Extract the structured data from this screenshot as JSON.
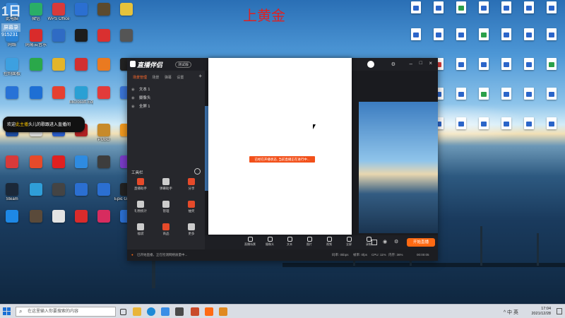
{
  "overlay": {
    "top_title": "上黄金",
    "logo_text": "1日",
    "logo_sub": "屏幕录",
    "logo_num": "915231",
    "notice_name": "此主播",
    "notice_text": "欢迎",
    "notice_rest": "头儿的歌跟进入直播间"
  },
  "desktop_icons_left": [
    {
      "label": "此电脑",
      "color": "#3c8ad8"
    },
    {
      "label": "微信",
      "color": "#2aae67"
    },
    {
      "label": "WPS Office",
      "color": "#d83a3a"
    },
    {
      "label": "",
      "color": "#2b6fd1"
    },
    {
      "label": "",
      "color": "#5b4a2e"
    },
    {
      "label": "",
      "color": "#e6c23b"
    },
    {
      "label": "网络",
      "color": "#2a83d6"
    },
    {
      "label": "网易云音乐",
      "color": "#d92b2b"
    },
    {
      "label": "",
      "color": "#2f6bc4"
    },
    {
      "label": "",
      "color": "#1d1d1d"
    },
    {
      "label": "",
      "color": "#d93030"
    },
    {
      "label": "",
      "color": "#555555"
    },
    {
      "label": "控制面板",
      "color": "#3da0e0"
    },
    {
      "label": "",
      "color": "#2aa84a"
    },
    {
      "label": "",
      "color": "#e3b52a"
    },
    {
      "label": "",
      "color": "#d23030"
    },
    {
      "label": "",
      "color": "#ea7a20"
    },
    {
      "label": "",
      "color": "#222222"
    },
    {
      "label": "",
      "color": "#2872d6"
    },
    {
      "label": "",
      "color": "#1e6fd4"
    },
    {
      "label": "",
      "color": "#e64030"
    },
    {
      "label": "Microsoft Edge",
      "color": "#2aa0d4"
    },
    {
      "label": "",
      "color": "#e23b3b"
    },
    {
      "label": "",
      "color": "#3a74d6"
    },
    {
      "label": "",
      "color": "#1e4ca0"
    },
    {
      "label": "",
      "color": "#d8d8d8"
    },
    {
      "label": "",
      "color": "#2a5cc8"
    },
    {
      "label": "",
      "color": "#b02222"
    },
    {
      "label": "PUBG",
      "color": "#c78a2a"
    },
    {
      "label": "",
      "color": "#f29a1f"
    },
    {
      "label": "",
      "color": "#d83a3a"
    },
    {
      "label": "",
      "color": "#e64a2a"
    },
    {
      "label": "",
      "color": "#e02020"
    },
    {
      "label": "",
      "color": "#2e8be0"
    },
    {
      "label": "",
      "color": "#3d3d3d"
    },
    {
      "label": "",
      "color": "#7a3bc8"
    },
    {
      "label": "Steam",
      "color": "#1b2838"
    },
    {
      "label": "",
      "color": "#2f9ed8"
    },
    {
      "label": "",
      "color": "#444444"
    },
    {
      "label": "",
      "color": "#2b6fd1"
    },
    {
      "label": "",
      "color": "#2b6fd1"
    },
    {
      "label": "Epic Games Launcher",
      "color": "#222222"
    },
    {
      "label": "",
      "color": "#1e88e5"
    },
    {
      "label": "",
      "color": "#5a4a3a"
    },
    {
      "label": "",
      "color": "#e3e3e3"
    },
    {
      "label": "",
      "color": "#d92b2b"
    },
    {
      "label": "",
      "color": "#d72c5f"
    },
    {
      "label": "",
      "color": "#2b6fd1"
    }
  ],
  "desktop_icons_right": [
    {
      "label": "",
      "color": "#2b65c9"
    },
    {
      "label": "",
      "color": "#2b65c9"
    },
    {
      "label": "",
      "color": "#2aa04a"
    },
    {
      "label": "",
      "color": "#2b65c9"
    },
    {
      "label": "",
      "color": "#2b65c9"
    },
    {
      "label": "",
      "color": "#2b65c9"
    },
    {
      "label": "",
      "color": "#2b65c9"
    },
    {
      "label": "",
      "color": "#2b65c9"
    },
    {
      "label": "",
      "color": "#2b65c9"
    },
    {
      "label": "",
      "color": "#2b65c9"
    },
    {
      "label": "",
      "color": "#2aa04a"
    },
    {
      "label": "",
      "color": "#2b65c9"
    },
    {
      "label": "",
      "color": "#2b65c9"
    },
    {
      "label": "",
      "color": "#2b65c9"
    },
    {
      "label": "",
      "color": "#2b65c9"
    },
    {
      "label": "",
      "color": "#d83a3a"
    },
    {
      "label": "",
      "color": "#2b65c9"
    },
    {
      "label": "",
      "color": "#2b65c9"
    },
    {
      "label": "",
      "color": "#2b65c9"
    },
    {
      "label": "",
      "color": "#2b65c9"
    },
    {
      "label": "",
      "color": "#2aa04a"
    },
    {
      "label": "",
      "color": "#2b65c9"
    },
    {
      "label": "",
      "color": "#2b65c9"
    },
    {
      "label": "",
      "color": "#2b65c9"
    },
    {
      "label": "",
      "color": "#2aa04a"
    },
    {
      "label": "",
      "color": "#2b65c9"
    },
    {
      "label": "",
      "color": "#2b65c9"
    },
    {
      "label": "",
      "color": "#2b65c9"
    },
    {
      "label": "",
      "color": "#2b65c9"
    },
    {
      "label": "",
      "color": "#2b65c9"
    },
    {
      "label": "",
      "color": "#2b65c9"
    },
    {
      "label": "",
      "color": "#2b65c9"
    },
    {
      "label": "",
      "color": "#2b65c9"
    },
    {
      "label": "",
      "color": "#2b65c9"
    },
    {
      "label": "",
      "color": "#2b65c9"
    }
  ],
  "app": {
    "title": "直播伴侣",
    "badge": "测试版",
    "tabs": [
      "场景管理",
      "场景",
      "弹幕",
      "设置"
    ],
    "sources": [
      "文本 1",
      "摄像头",
      "全屏 1"
    ],
    "tools_header": "工具栏",
    "tools": [
      {
        "label": "直播助手",
        "color": "#e64a2a"
      },
      {
        "label": "弹幕助手",
        "color": "#cccccc"
      },
      {
        "label": "分享",
        "color": "#e64a2a"
      },
      {
        "label": "礼物统计",
        "color": "#cccccc"
      },
      {
        "label": "管理",
        "color": "#cccccc"
      },
      {
        "label": "抽奖",
        "color": "#e64a2a"
      },
      {
        "label": "福袋",
        "color": "#cccccc"
      },
      {
        "label": "商品",
        "color": "#e64a2a"
      },
      {
        "label": "更多",
        "color": "#cccccc"
      }
    ],
    "controls": [
      "直播场景",
      "摄像头",
      "文本",
      "图片",
      "视频",
      "全屏",
      "录制"
    ],
    "live_button": "开始直播",
    "status_items": [
      "码率: 0kbps",
      "帧率: 0fps",
      "CPU: 11%",
      "内存: 36%",
      "00:00:05"
    ],
    "status_warning": "已开始直播，正在检测网络质量中..."
  },
  "error_toast": "已经在开播状态, 当前直播正在进行中...",
  "taskbar": {
    "search_placeholder": "在这里输入你要搜索的内容",
    "search_icon": "search-icon",
    "time": "17:04",
    "date": "2021/12/28",
    "tray": "^ 中 英"
  },
  "colors": {
    "accent": "#ff6a13",
    "title_red": "#e02020",
    "taskbar": "#d9dde4"
  }
}
